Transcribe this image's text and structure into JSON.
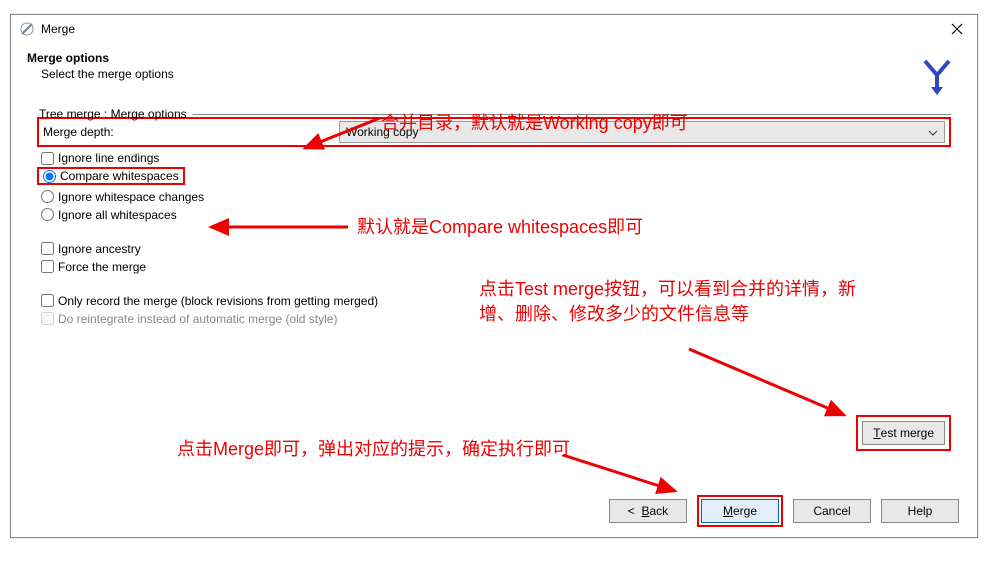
{
  "window": {
    "title": "Merge"
  },
  "header": {
    "title": "Merge options",
    "subtitle": "Select the merge options"
  },
  "group": {
    "label": "Tree merge : Merge options",
    "depth_label": "Merge depth:",
    "depth_value": "Working copy"
  },
  "checks": {
    "ignore_line_endings": "Ignore line endings",
    "compare_whitespaces": "Compare whitespaces",
    "ignore_whitespace_changes": "Ignore whitespace changes",
    "ignore_all_whitespaces": "Ignore all whitespaces",
    "ignore_ancestry": "Ignore ancestry",
    "force_merge": "Force the merge",
    "only_record": "Only record the merge (block revisions from getting merged)",
    "do_reintegrate": "Do reintegrate instead of automatic merge (old style)"
  },
  "buttons": {
    "test_merge": "Test merge",
    "back": "<  Back",
    "merge": "Merge",
    "cancel": "Cancel",
    "help": "Help"
  },
  "annotations": {
    "a1": "合并目录，默认就是Working copy即可",
    "a2": "默认就是Compare whitespaces即可",
    "a3": "点击Test merge按钮，可以看到合并的详情，新增、删除、修改多少的文件信息等",
    "a4": "点击Merge即可，弹出对应的提示，确定执行即可"
  }
}
